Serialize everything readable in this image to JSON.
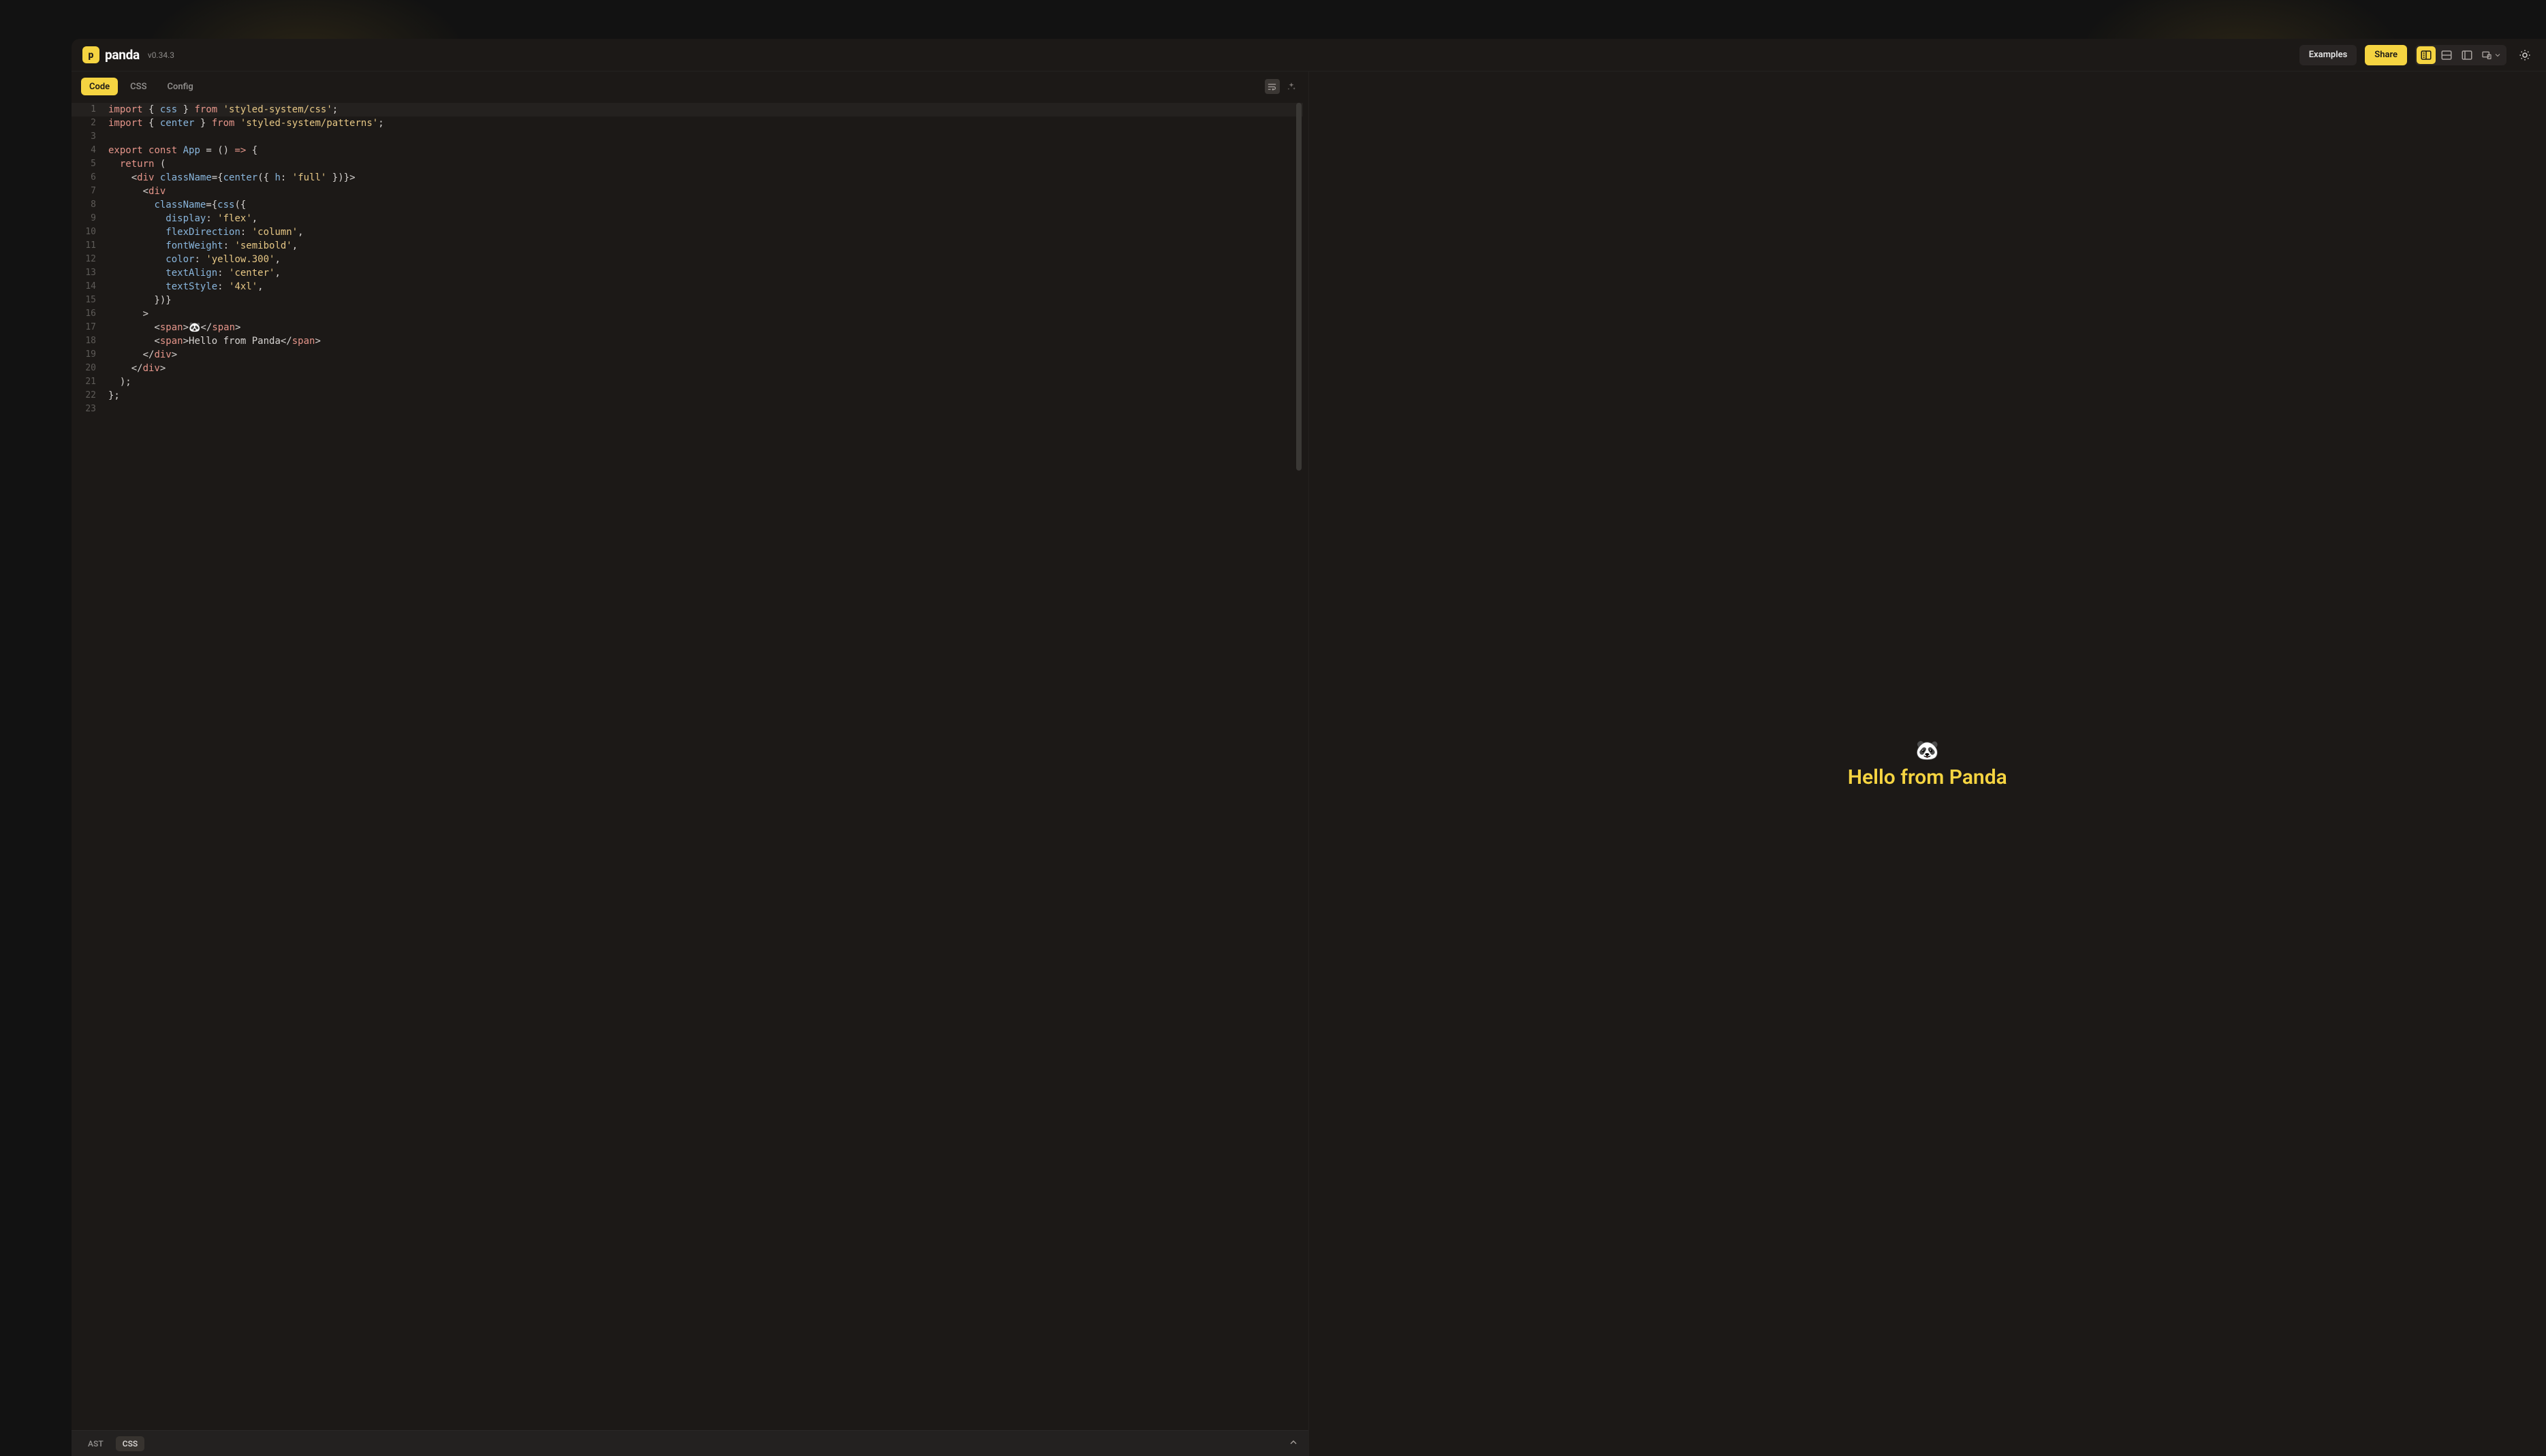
{
  "brand": {
    "name": "panda",
    "badge_letter": "p",
    "version": "v0.34.3"
  },
  "header": {
    "examples": "Examples",
    "share": "Share"
  },
  "editor_tabs": {
    "code": "Code",
    "css": "CSS",
    "config": "Config"
  },
  "bottom": {
    "ast": "AST",
    "css": "CSS"
  },
  "preview": {
    "emoji": "🐼",
    "text": "Hello from Panda"
  },
  "code": {
    "line_count": 23,
    "raw": "import { css } from 'styled-system/css';\nimport { center } from 'styled-system/patterns';\n\nexport const App = () => {\n  return (\n    <div className={center({ h: 'full' })}>\n      <div\n        className={css({\n          display: 'flex',\n          flexDirection: 'column',\n          fontWeight: 'semibold',\n          color: 'yellow.300',\n          textAlign: 'center',\n          textStyle: '4xl',\n        })}\n      >\n        <span>🐼</span>\n        <span>Hello from Panda</span>\n      </div>\n    </div>\n  );\n};\n",
    "lines": [
      [
        [
          "kw",
          "import"
        ],
        [
          "pun",
          " { "
        ],
        [
          "fn",
          "css"
        ],
        [
          "pun",
          " } "
        ],
        [
          "kw",
          "from"
        ],
        [
          "pun",
          " "
        ],
        [
          "str",
          "'styled-system/css'"
        ],
        [
          "pun",
          ";"
        ]
      ],
      [
        [
          "kw",
          "import"
        ],
        [
          "pun",
          " { "
        ],
        [
          "fn",
          "center"
        ],
        [
          "pun",
          " } "
        ],
        [
          "kw",
          "from"
        ],
        [
          "pun",
          " "
        ],
        [
          "str",
          "'styled-system/patterns'"
        ],
        [
          "pun",
          ";"
        ]
      ],
      [],
      [
        [
          "kw",
          "export"
        ],
        [
          "pun",
          " "
        ],
        [
          "kw",
          "const"
        ],
        [
          "pun",
          " "
        ],
        [
          "fn",
          "App"
        ],
        [
          "pun",
          " = () "
        ],
        [
          "kw",
          "=>"
        ],
        [
          "pun",
          " {"
        ]
      ],
      [
        [
          "pun",
          "  "
        ],
        [
          "kw",
          "return"
        ],
        [
          "pun",
          " ("
        ]
      ],
      [
        [
          "pun",
          "    <"
        ],
        [
          "tag",
          "div"
        ],
        [
          "pun",
          " "
        ],
        [
          "attr",
          "className"
        ],
        [
          "pun",
          "={"
        ],
        [
          "fn",
          "center"
        ],
        [
          "pun",
          "({ "
        ],
        [
          "prop",
          "h"
        ],
        [
          "pun",
          ": "
        ],
        [
          "str",
          "'full'"
        ],
        [
          "pun",
          " })}>"
        ]
      ],
      [
        [
          "pun",
          "      <"
        ],
        [
          "tag",
          "div"
        ]
      ],
      [
        [
          "pun",
          "        "
        ],
        [
          "attr",
          "className"
        ],
        [
          "pun",
          "={"
        ],
        [
          "fn",
          "css"
        ],
        [
          "pun",
          "({"
        ]
      ],
      [
        [
          "pun",
          "          "
        ],
        [
          "prop",
          "display"
        ],
        [
          "pun",
          ": "
        ],
        [
          "str",
          "'flex'"
        ],
        [
          "pun",
          ","
        ]
      ],
      [
        [
          "pun",
          "          "
        ],
        [
          "prop",
          "flexDirection"
        ],
        [
          "pun",
          ": "
        ],
        [
          "str",
          "'column'"
        ],
        [
          "pun",
          ","
        ]
      ],
      [
        [
          "pun",
          "          "
        ],
        [
          "prop",
          "fontWeight"
        ],
        [
          "pun",
          ": "
        ],
        [
          "str",
          "'semibold'"
        ],
        [
          "pun",
          ","
        ]
      ],
      [
        [
          "pun",
          "          "
        ],
        [
          "prop",
          "color"
        ],
        [
          "pun",
          ": "
        ],
        [
          "str",
          "'yellow.300'"
        ],
        [
          "pun",
          ","
        ]
      ],
      [
        [
          "pun",
          "          "
        ],
        [
          "prop",
          "textAlign"
        ],
        [
          "pun",
          ": "
        ],
        [
          "str",
          "'center'"
        ],
        [
          "pun",
          ","
        ]
      ],
      [
        [
          "pun",
          "          "
        ],
        [
          "prop",
          "textStyle"
        ],
        [
          "pun",
          ": "
        ],
        [
          "str",
          "'4xl'"
        ],
        [
          "pun",
          ","
        ]
      ],
      [
        [
          "pun",
          "        })}"
        ]
      ],
      [
        [
          "pun",
          "      >"
        ]
      ],
      [
        [
          "pun",
          "        <"
        ],
        [
          "tag",
          "span"
        ],
        [
          "pun",
          ">"
        ],
        [
          "txt",
          "🐼"
        ],
        [
          "pun",
          "</"
        ],
        [
          "tag",
          "span"
        ],
        [
          "pun",
          ">"
        ]
      ],
      [
        [
          "pun",
          "        <"
        ],
        [
          "tag",
          "span"
        ],
        [
          "pun",
          ">"
        ],
        [
          "txt",
          "Hello from Panda"
        ],
        [
          "pun",
          "</"
        ],
        [
          "tag",
          "span"
        ],
        [
          "pun",
          ">"
        ]
      ],
      [
        [
          "pun",
          "      </"
        ],
        [
          "tag",
          "div"
        ],
        [
          "pun",
          ">"
        ]
      ],
      [
        [
          "pun",
          "    </"
        ],
        [
          "tag",
          "div"
        ],
        [
          "pun",
          ">"
        ]
      ],
      [
        [
          "pun",
          "  );"
        ]
      ],
      [
        [
          "pun",
          "};"
        ]
      ],
      []
    ]
  },
  "colors": {
    "accent": "#f5d441",
    "bg": "#1c1917"
  }
}
